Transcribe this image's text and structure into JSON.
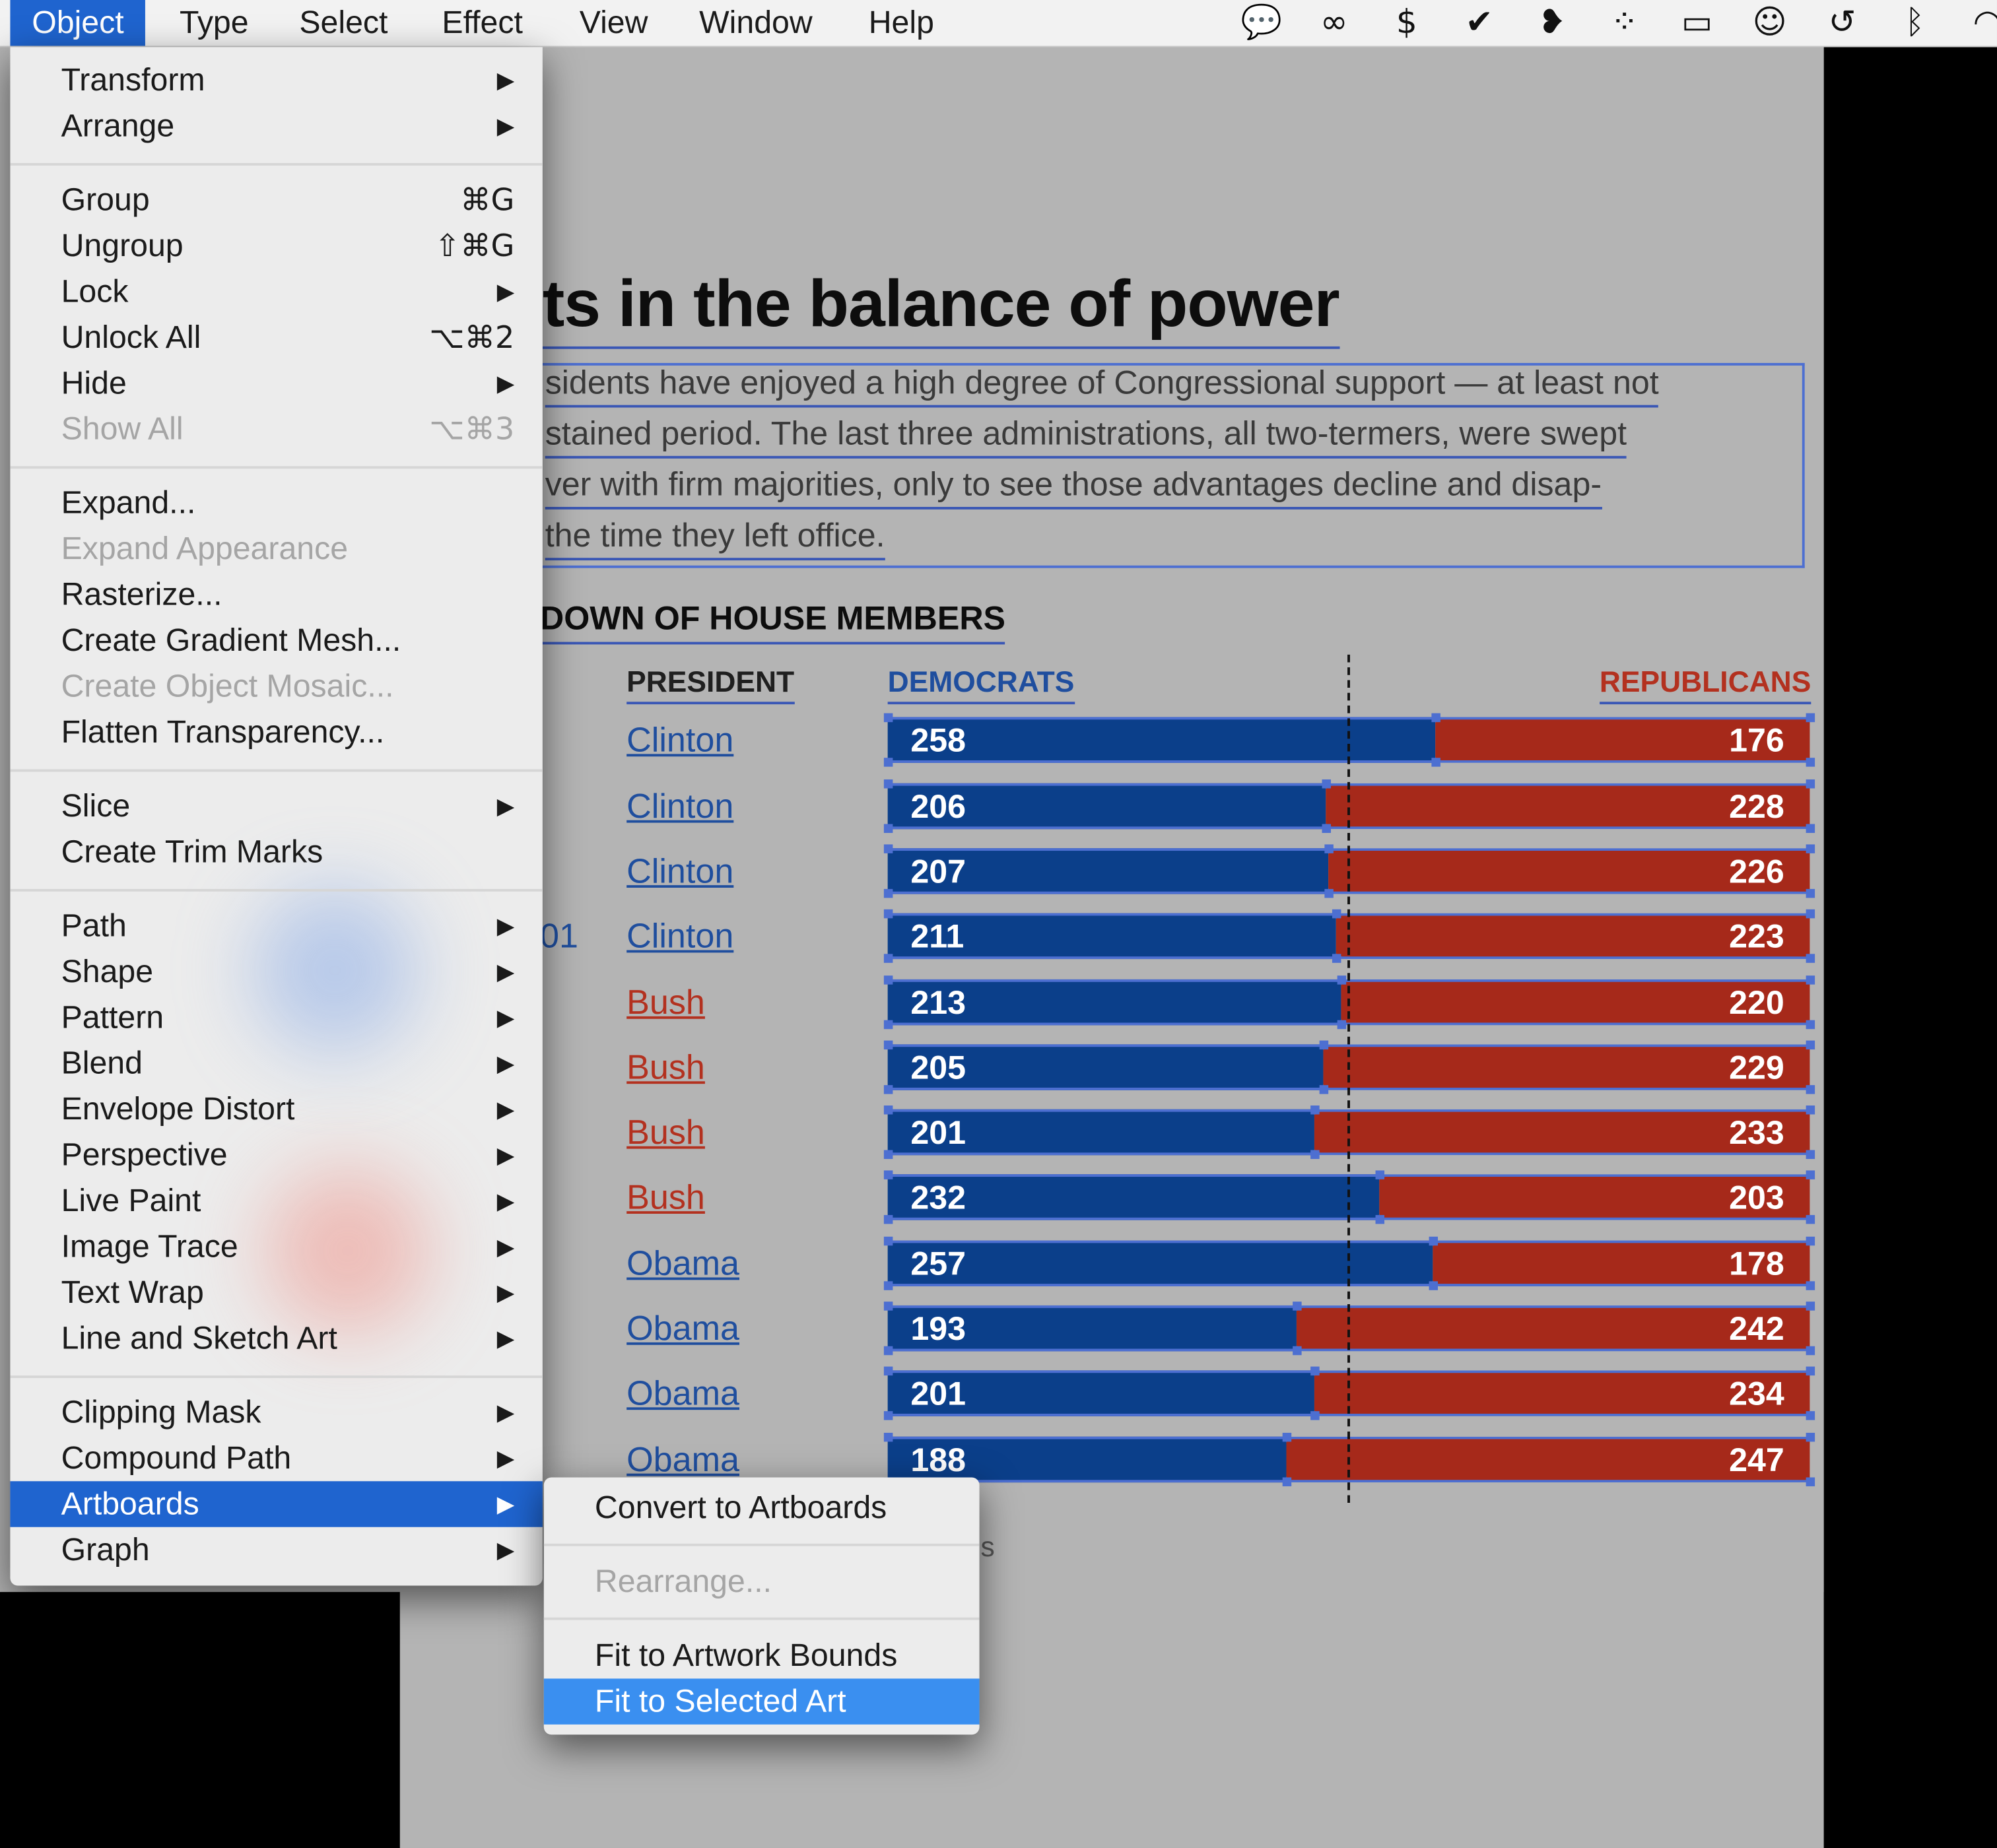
{
  "menubar": {
    "items": [
      "Object",
      "Type",
      "Select",
      "Effect",
      "View",
      "Window",
      "Help"
    ],
    "active": "Object",
    "tray_icons": [
      "chat-bubble-icon",
      "creative-cloud-icon",
      "money-icon",
      "checkmark-icon",
      "bird-icon",
      "wireless-audio-icon",
      "airplay-icon",
      "accessibility-icon",
      "time-machine-icon",
      "bluetooth-icon",
      "wifi-icon"
    ]
  },
  "object_menu": [
    {
      "label": "Transform",
      "submenu": true
    },
    {
      "label": "Arrange",
      "submenu": true
    },
    {
      "sep": true
    },
    {
      "label": "Group",
      "shortcut": "⌘G"
    },
    {
      "label": "Ungroup",
      "shortcut": "⇧⌘G"
    },
    {
      "label": "Lock",
      "submenu": true
    },
    {
      "label": "Unlock All",
      "shortcut": "⌥⌘2"
    },
    {
      "label": "Hide",
      "submenu": true
    },
    {
      "label": "Show All",
      "shortcut": "⌥⌘3",
      "disabled": true
    },
    {
      "sep": true
    },
    {
      "label": "Expand..."
    },
    {
      "label": "Expand Appearance",
      "disabled": true
    },
    {
      "label": "Rasterize..."
    },
    {
      "label": "Create Gradient Mesh..."
    },
    {
      "label": "Create Object Mosaic...",
      "disabled": true
    },
    {
      "label": "Flatten Transparency..."
    },
    {
      "sep": true
    },
    {
      "label": "Slice",
      "submenu": true
    },
    {
      "label": "Create Trim Marks"
    },
    {
      "sep": true
    },
    {
      "label": "Path",
      "submenu": true
    },
    {
      "label": "Shape",
      "submenu": true
    },
    {
      "label": "Pattern",
      "submenu": true
    },
    {
      "label": "Blend",
      "submenu": true
    },
    {
      "label": "Envelope Distort",
      "submenu": true
    },
    {
      "label": "Perspective",
      "submenu": true
    },
    {
      "label": "Live Paint",
      "submenu": true
    },
    {
      "label": "Image Trace",
      "submenu": true
    },
    {
      "label": "Text Wrap",
      "submenu": true
    },
    {
      "label": "Line and Sketch Art",
      "submenu": true
    },
    {
      "sep": true
    },
    {
      "label": "Clipping Mask",
      "submenu": true
    },
    {
      "label": "Compound Path",
      "submenu": true
    },
    {
      "label": "Artboards",
      "submenu": true,
      "highlighted": true
    },
    {
      "label": "Graph",
      "submenu": true
    }
  ],
  "artboards_submenu": [
    {
      "label": "Convert to Artboards"
    },
    {
      "sep": true
    },
    {
      "label": "Rearrange...",
      "disabled": true
    },
    {
      "sep": true
    },
    {
      "label": "Fit to Artwork Bounds"
    },
    {
      "label": "Fit to Selected Art",
      "highlighted": true
    }
  ],
  "artwork": {
    "headline": "ts in the balance of power",
    "intro_lines": [
      "sidents have enjoyed a high degree of Congressional support — at least not",
      "stained period. The last three administrations, all two-termers, were swept",
      "ver with firm majorities, only to see those advantages decline and disap-",
      "the time they left office."
    ],
    "subhead": "DOWN OF HOUSE MEMBERS",
    "col_president": "PRESIDENT",
    "col_democrats": "DEMOCRATS",
    "col_republicans": "REPUBLICANS",
    "year_fragment": "01",
    "obscured_fragment": "s",
    "colors": {
      "democrat": "#0b3f8a",
      "republican": "#a6291a",
      "selection": "#4d6fd1"
    }
  },
  "chart_data": {
    "type": "bar",
    "stacked": true,
    "orientation": "horizontal",
    "categories": [
      "Clinton",
      "Clinton",
      "Clinton",
      "Clinton",
      "Bush",
      "Bush",
      "Bush",
      "Bush",
      "Obama",
      "Obama",
      "Obama",
      "Obama"
    ],
    "party": [
      "dem",
      "dem",
      "dem",
      "dem",
      "rep",
      "rep",
      "rep",
      "rep",
      "dem",
      "dem",
      "dem",
      "dem"
    ],
    "series": [
      {
        "name": "DEMOCRATS",
        "values": [
          258,
          206,
          207,
          211,
          213,
          205,
          201,
          232,
          257,
          193,
          201,
          188
        ]
      },
      {
        "name": "REPUBLICANS",
        "values": [
          176,
          228,
          226,
          223,
          220,
          229,
          233,
          203,
          178,
          242,
          234,
          247
        ]
      }
    ]
  }
}
